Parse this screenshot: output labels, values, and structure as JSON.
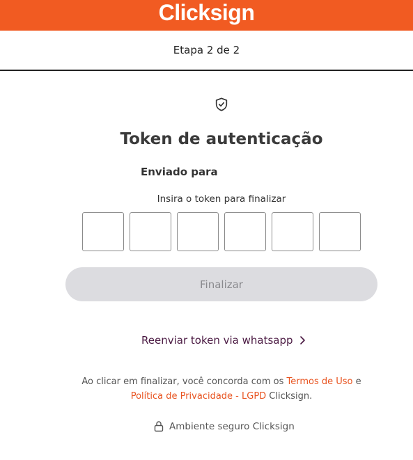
{
  "header": {
    "logo_text": "Clicksign",
    "brand_color": "#f15b22"
  },
  "step": {
    "label": "Etapa 2 de 2"
  },
  "main": {
    "shield_icon": "shield-check-icon",
    "title": "Token de autenticação",
    "sent_to_label": "Enviado para",
    "instruction": "Insira o token para finalizar",
    "token_digits": [
      "",
      "",
      "",
      "",
      "",
      ""
    ],
    "finish_label": "Finalizar",
    "resend_label": "Reenviar token via whatsapp",
    "resend_icon": "chevron-right-icon"
  },
  "legal": {
    "part1": "Ao clicar em finalizar, você concorda com os ",
    "terms_link": "Termos de Uso",
    "part2": " e",
    "privacy_link": "Política de Privacidade - LGPD",
    "part3": " Clicksign."
  },
  "footer": {
    "secure_label": "Ambiente seguro Clicksign",
    "lock_icon": "lock-icon"
  }
}
